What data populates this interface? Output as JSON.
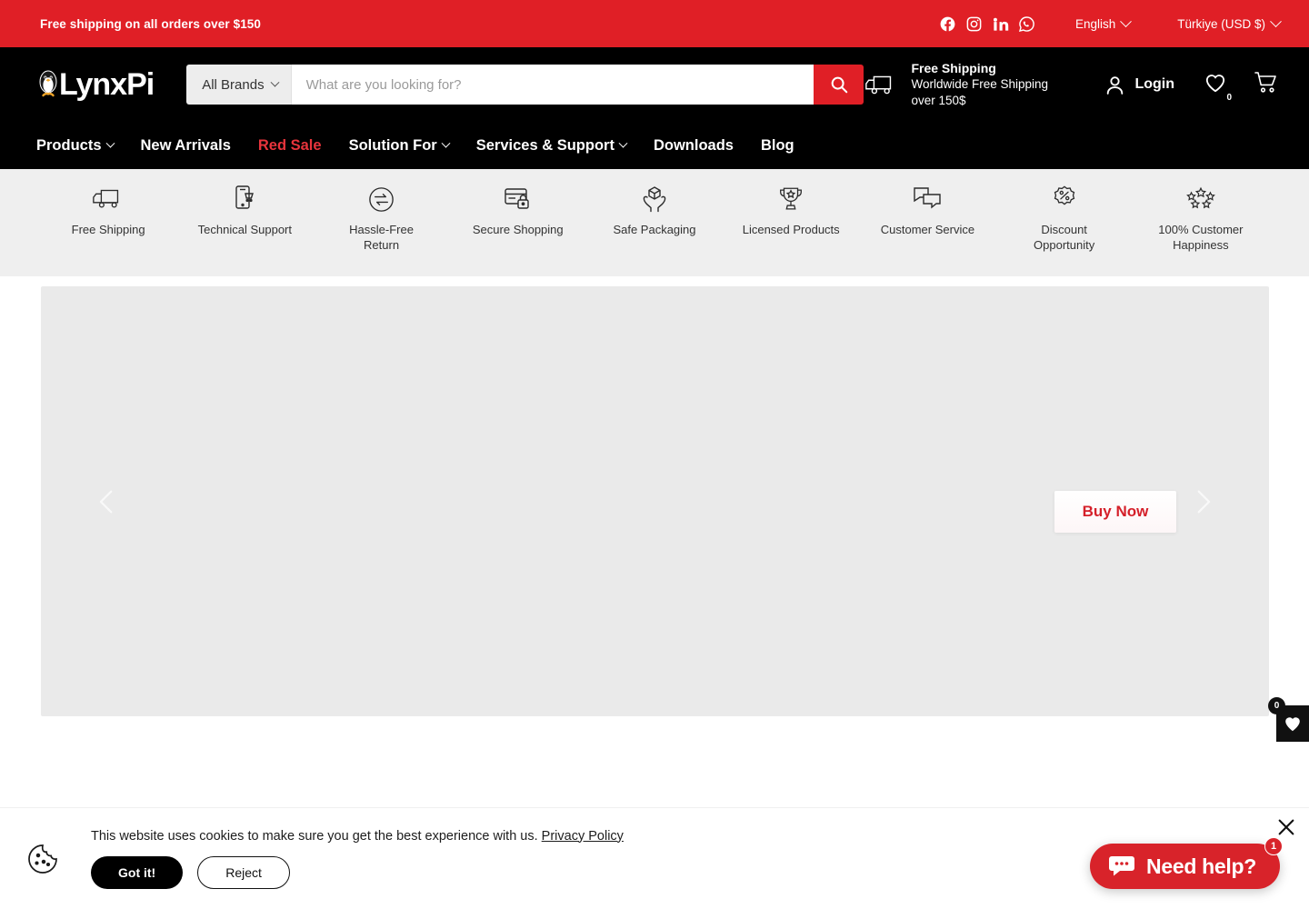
{
  "announcement": {
    "text": "Free shipping on all orders over $150",
    "social": [
      {
        "name": "facebook-icon",
        "label": "Facebook"
      },
      {
        "name": "instagram-icon",
        "label": "Instagram"
      },
      {
        "name": "linkedin-icon",
        "label": "LinkedIn"
      },
      {
        "name": "whatsapp-icon",
        "label": "WhatsApp"
      }
    ],
    "language": "English",
    "country_currency": "Türkiye (USD $)"
  },
  "header": {
    "logo_text": "LynxPi",
    "brand_select": "All Brands",
    "search_placeholder": "What are you looking for?",
    "search_value": "",
    "shipping_title": "Free Shipping",
    "shipping_sub": "Worldwide Free Shipping over 150$",
    "login_label": "Login",
    "wishlist_count": "0",
    "cart_count": ""
  },
  "nav": {
    "items": [
      {
        "label": "Products",
        "caret": true,
        "sale": false
      },
      {
        "label": "New Arrivals",
        "caret": false,
        "sale": false
      },
      {
        "label": "Red Sale",
        "caret": false,
        "sale": true
      },
      {
        "label": "Solution For",
        "caret": true,
        "sale": false
      },
      {
        "label": "Services & Support",
        "caret": true,
        "sale": false
      },
      {
        "label": "Downloads",
        "caret": false,
        "sale": false
      },
      {
        "label": "Blog",
        "caret": false,
        "sale": false
      }
    ]
  },
  "features": [
    {
      "icon": "truck-icon",
      "label": "Free Shipping"
    },
    {
      "icon": "phone-cart-icon",
      "label": "Technical Support"
    },
    {
      "icon": "return-arrows-icon",
      "label": "Hassle-Free Return"
    },
    {
      "icon": "card-lock-icon",
      "label": "Secure Shopping"
    },
    {
      "icon": "hands-box-icon",
      "label": "Safe Packaging"
    },
    {
      "icon": "trophy-star-icon",
      "label": "Licensed Products"
    },
    {
      "icon": "chat-bubbles-icon",
      "label": "Customer Service"
    },
    {
      "icon": "discount-badge-icon",
      "label": "Discount Opportunity"
    },
    {
      "icon": "stars-icon",
      "label": "100% Customer Happiness"
    }
  ],
  "hero": {
    "buy_now_label": "Buy Now",
    "prev_label": "Previous slide",
    "next_label": "Next slide"
  },
  "floating": {
    "wishlist_count": "0"
  },
  "cookie": {
    "text": "This website uses cookies to make sure you get the best experience with us.",
    "privacy_link": "Privacy Policy",
    "accept_label": "Got it!",
    "reject_label": "Reject"
  },
  "chat": {
    "label": "Need help?",
    "badge": "1"
  },
  "colors": {
    "brand_red": "#e01f26",
    "chat_red": "#d8232a",
    "sale_red": "#e8343c",
    "header_black": "#000000",
    "feature_bg": "#efefef",
    "banner_bg": "#eaeaea"
  }
}
